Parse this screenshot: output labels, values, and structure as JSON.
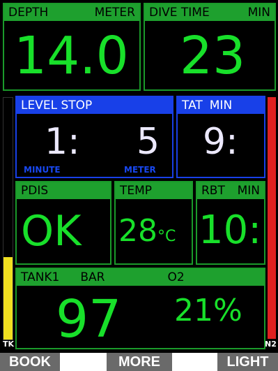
{
  "depth": {
    "label": "DEPTH",
    "unit": "METER",
    "value": "14.0"
  },
  "dive_time": {
    "label": "DIVE TIME",
    "unit": "MIN",
    "value": "23"
  },
  "level_stop": {
    "label": "LEVEL STOP",
    "minutes": "1:",
    "meters": "5",
    "minute_label": "MINUTE",
    "meter_label": "METER"
  },
  "tat": {
    "label": "TAT",
    "unit": "MIN",
    "value": "9:"
  },
  "pdis": {
    "label": "PDIS",
    "value": "OK"
  },
  "temp": {
    "label": "TEMP",
    "value": "28",
    "unit": "°C"
  },
  "rbt": {
    "label": "RBT",
    "unit": "MIN",
    "value": "10:"
  },
  "tank": {
    "label": "TANK1",
    "unit": "BAR",
    "o2_label": "O2",
    "pressure": "97",
    "o2": "21%"
  },
  "side": {
    "left_label": "TK",
    "right_label": "N2",
    "tank_level": 0.34,
    "n2_level": 1.0,
    "left_color": "#f0e020",
    "right_color": "#e02020"
  },
  "buttons": {
    "book": "BOOK",
    "more": "MORE",
    "light": "LIGHT"
  }
}
